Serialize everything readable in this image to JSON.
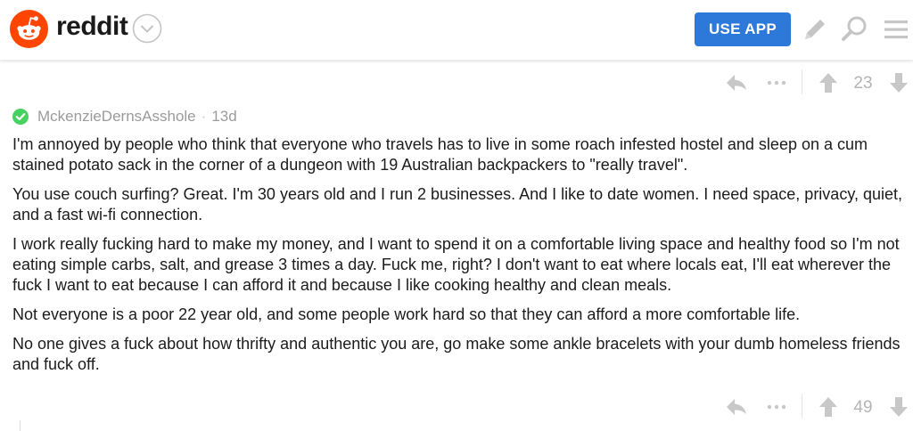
{
  "header": {
    "brand": "reddit",
    "use_app_label": "USE APP",
    "icons": [
      "reddit-alien-icon",
      "chevron-down-icon",
      "pencil-icon",
      "search-icon",
      "hamburger-menu-icon"
    ],
    "brand_color": "#ff4500",
    "button_color": "#2d79d9"
  },
  "top_actions": {
    "score": "23"
  },
  "comment": {
    "author": "MckenzieDernsAsshole",
    "separator": "·",
    "age": "13d",
    "paragraphs": [
      "I'm annoyed by people who think that everyone who travels has to live in some roach infested hostel and sleep on a cum stained potato sack in the corner of a dungeon with 19 Australian backpackers to \"really travel\".",
      "You use couch surfing? Great. I'm 30 years old and I run 2 businesses. And I like to date women. I need space, privacy, quiet, and a fast wi-fi connection.",
      "I work really fucking hard to make my money, and I want to spend it on a comfortable living space and healthy food so I'm not eating simple carbs, salt, and grease 3 times a day. Fuck me, right? I don't want to eat where locals eat, I'll eat wherever the fuck I want to eat because I can afford it and because I like cooking healthy and clean meals.",
      "Not everyone is a poor 22 year old, and some people work hard so that they can afford a more comfortable life.",
      "No one gives a fuck about how thrifty and authentic you are, go make some ankle bracelets with your dumb homeless friends and fuck off."
    ],
    "verified_color": "#46d160"
  },
  "bottom_actions": {
    "score": "49"
  }
}
